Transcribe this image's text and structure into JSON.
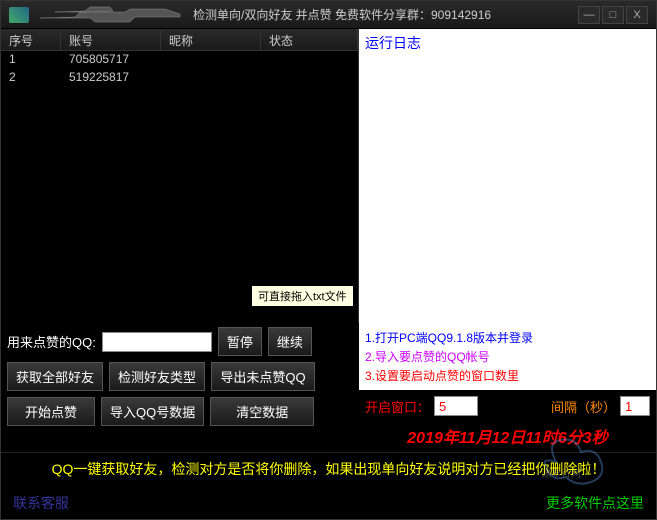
{
  "titlebar": {
    "title": "检测单向/双向好友 并点赞  免费软件分享群：909142916",
    "minimize": "—",
    "maximize": "□",
    "close": "X"
  },
  "table": {
    "headers": {
      "seq": "序号",
      "account": "账号",
      "nickname": "昵称",
      "status": "状态"
    },
    "rows": [
      {
        "seq": "1",
        "account": "705805717",
        "nickname": "",
        "status": ""
      },
      {
        "seq": "2",
        "account": "519225817",
        "nickname": "",
        "status": ""
      }
    ]
  },
  "tooltip": "可直接拖入txt文件",
  "log": {
    "title": "运行日志"
  },
  "instructions": {
    "line1": "1.打开PC端QQ9.1.8版本并登录",
    "line2": "2.导入要点赞的QQ帐号",
    "line3": "3.设置要启动点赞的窗口数里"
  },
  "controls": {
    "qq_label": "用来点赞的QQ:",
    "qq_value": "",
    "pause": "暂停",
    "resume": "继续",
    "get_friends": "获取全部好友",
    "detect_type": "检测好友类型",
    "export_unliked": "导出未点赞QQ",
    "start_like": "开始点赞",
    "import_qq": "导入QQ号数据",
    "clear_data": "清空数据",
    "open_window_label": "开启窗口：",
    "open_window_value": "5",
    "interval_label": "间隔（秒）",
    "interval_value": "1",
    "timestamp": "2019年11月12日11时6分3秒"
  },
  "banner": "QQ一键获取好友，检测对方是否将你删除，如果出现单向好友说明对方已经把你删除啦！",
  "footer": {
    "contact": "联系客服",
    "more": "更多软件点这里"
  }
}
